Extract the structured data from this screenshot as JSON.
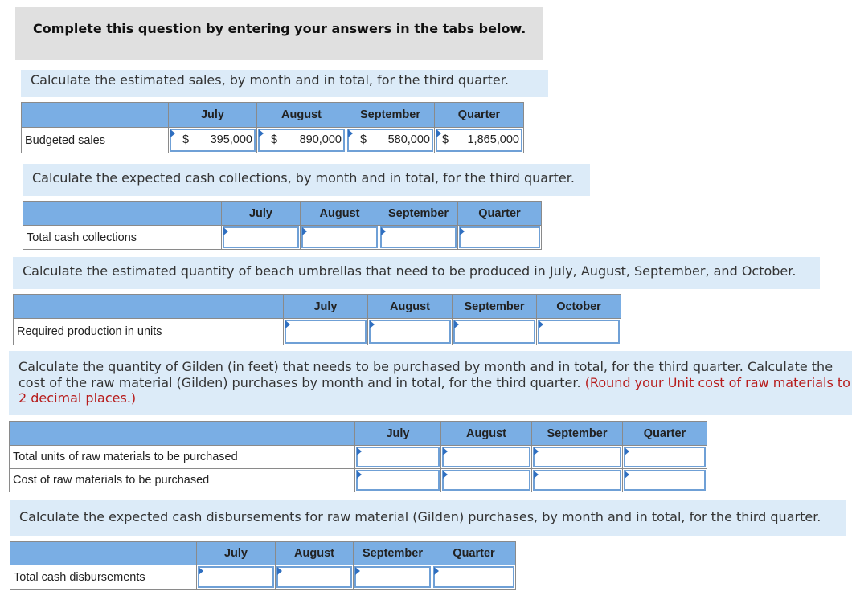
{
  "banner": "Complete this question by entering your answers in the tabs below.",
  "sections": {
    "sales": {
      "prompt": "Calculate the estimated sales, by month and in total, for the third quarter.",
      "columns": [
        "July",
        "August",
        "September",
        "Quarter"
      ],
      "rows": [
        {
          "label": "Budgeted sales",
          "cells": [
            {
              "currency": "$",
              "value": "395,000"
            },
            {
              "currency": "$",
              "value": "890,000"
            },
            {
              "currency": "$",
              "value": "580,000"
            },
            {
              "currency": "$",
              "value": "1,865,000"
            }
          ]
        }
      ]
    },
    "collections": {
      "prompt": "Calculate the expected cash collections, by month and in total, for the third quarter.",
      "columns": [
        "July",
        "August",
        "September",
        "Quarter"
      ],
      "rows": [
        {
          "label": "Total cash collections",
          "cells": [
            "",
            "",
            "",
            ""
          ]
        }
      ]
    },
    "production": {
      "prompt": "Calculate the estimated quantity of beach umbrellas that need to be produced in July, August, September, and October.",
      "columns": [
        "July",
        "August",
        "September",
        "October"
      ],
      "rows": [
        {
          "label": "Required production in units",
          "cells": [
            "",
            "",
            "",
            ""
          ]
        }
      ]
    },
    "purchases": {
      "prompt": "Calculate the quantity of Gilden (in feet) that needs to be purchased by month and in total, for the third quarter. Calculate the cost of the raw material (Gilden) purchases by month and in total, for the third quarter.",
      "note": "(Round your Unit cost of raw materials to 2 decimal places.)",
      "columns": [
        "July",
        "August",
        "September",
        "Quarter"
      ],
      "rows": [
        {
          "label": "Total units of raw materials to be purchased",
          "cells": [
            "",
            "",
            "",
            ""
          ]
        },
        {
          "label": "Cost of raw materials to be purchased",
          "cells": [
            "",
            "",
            "",
            ""
          ]
        }
      ]
    },
    "disbursements": {
      "prompt": "Calculate the expected cash disbursements for raw material (Gilden) purchases, by month and in total, for the third quarter.",
      "columns": [
        "July",
        "August",
        "September",
        "Quarter"
      ],
      "rows": [
        {
          "label": "Total cash disbursements",
          "cells": [
            "",
            "",
            "",
            ""
          ]
        }
      ]
    }
  },
  "colors": {
    "header_blue": "#7aaee4",
    "prompt_bg": "#dcebf8",
    "note_red": "#b71c1c",
    "input_border": "#6fa0d6"
  }
}
